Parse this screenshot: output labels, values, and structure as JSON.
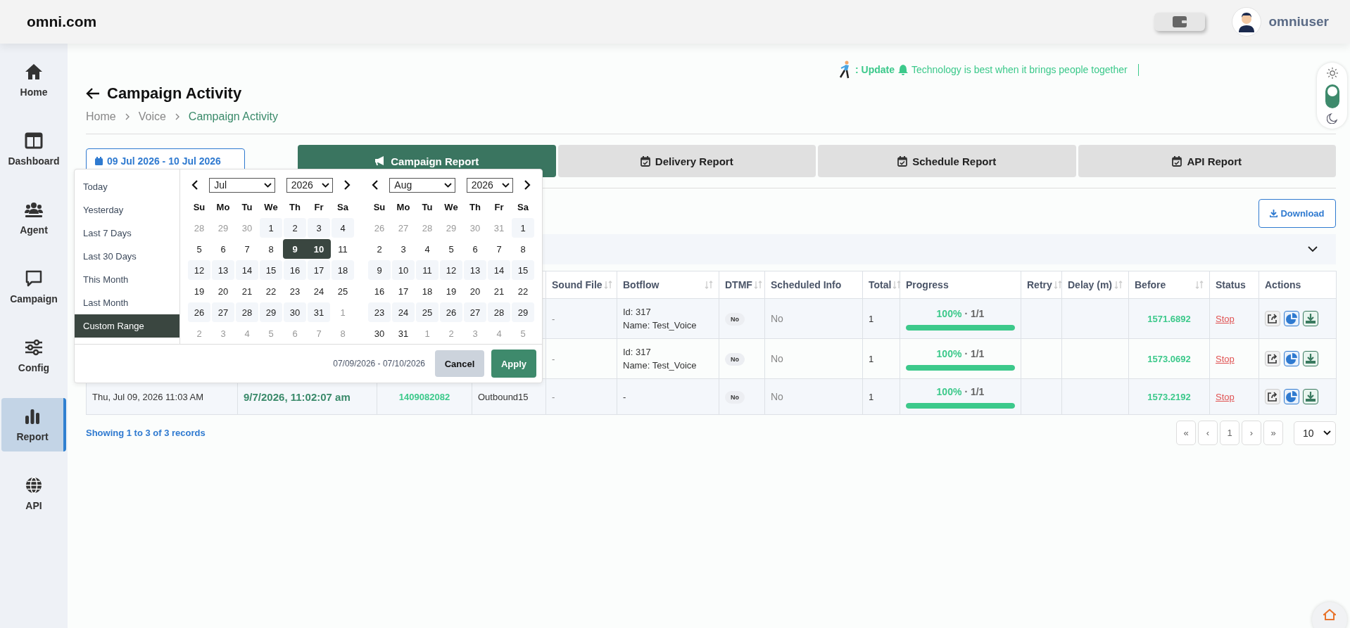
{
  "header": {
    "logo": "omni.com",
    "user": "omniuser"
  },
  "sidebar": {
    "items": [
      {
        "label": "Home",
        "selected": false
      },
      {
        "label": "Dashboard",
        "selected": false
      },
      {
        "label": "Agent",
        "selected": false
      },
      {
        "label": "Campaign",
        "selected": false
      },
      {
        "label": "Config",
        "selected": false
      },
      {
        "label": "Report",
        "selected": true
      },
      {
        "label": "API",
        "selected": false
      }
    ]
  },
  "ticker": {
    "label": ": Update",
    "message": "Technology is best when it brings people together"
  },
  "theme_toggle": {
    "on": false
  },
  "page": {
    "title": "Campaign Activity",
    "breadcrumb": [
      "Home",
      "Voice",
      "Campaign Activity"
    ]
  },
  "date_range": {
    "value": "09 Jul 2026 - 10 Jul 2026"
  },
  "tabs": [
    {
      "label": "Campaign Report",
      "selected": true
    },
    {
      "label": "Delivery Report",
      "selected": false
    },
    {
      "label": "Schedule Report",
      "selected": false
    },
    {
      "label": "API Report",
      "selected": false
    }
  ],
  "download_button": "Download",
  "date_picker": {
    "ranges": [
      {
        "label": "Today",
        "selected": false
      },
      {
        "label": "Yesterday",
        "selected": false
      },
      {
        "label": "Last 7 Days",
        "selected": false
      },
      {
        "label": "Last 30 Days",
        "selected": false
      },
      {
        "label": "This Month",
        "selected": false
      },
      {
        "label": "Last Month",
        "selected": false
      },
      {
        "label": "Custom Range",
        "selected": true
      }
    ],
    "calendars": [
      {
        "month": "Jul",
        "year": "2026",
        "days_of_week": [
          "Su",
          "Mo",
          "Tu",
          "We",
          "Th",
          "Fr",
          "Sa"
        ],
        "weeks": [
          [
            {
              "day": "28",
              "outside": true,
              "selected": false
            },
            {
              "day": "29",
              "outside": true,
              "selected": false
            },
            {
              "day": "30",
              "outside": true,
              "selected": false
            },
            {
              "day": "1",
              "outside": false,
              "selected": false
            },
            {
              "day": "2",
              "outside": false,
              "selected": false
            },
            {
              "day": "3",
              "outside": false,
              "selected": false
            },
            {
              "day": "4",
              "outside": false,
              "selected": false
            }
          ],
          [
            {
              "day": "5",
              "outside": false,
              "selected": false
            },
            {
              "day": "6",
              "outside": false,
              "selected": false
            },
            {
              "day": "7",
              "outside": false,
              "selected": false
            },
            {
              "day": "8",
              "outside": false,
              "selected": false
            },
            {
              "day": "9",
              "outside": false,
              "selected": true
            },
            {
              "day": "10",
              "outside": false,
              "selected": true
            },
            {
              "day": "11",
              "outside": false,
              "selected": false
            }
          ],
          [
            {
              "day": "12",
              "outside": false,
              "selected": false
            },
            {
              "day": "13",
              "outside": false,
              "selected": false
            },
            {
              "day": "14",
              "outside": false,
              "selected": false
            },
            {
              "day": "15",
              "outside": false,
              "selected": false
            },
            {
              "day": "16",
              "outside": false,
              "selected": false
            },
            {
              "day": "17",
              "outside": false,
              "selected": false
            },
            {
              "day": "18",
              "outside": false,
              "selected": false
            }
          ],
          [
            {
              "day": "19",
              "outside": false,
              "selected": false
            },
            {
              "day": "20",
              "outside": false,
              "selected": false
            },
            {
              "day": "21",
              "outside": false,
              "selected": false
            },
            {
              "day": "22",
              "outside": false,
              "selected": false
            },
            {
              "day": "23",
              "outside": false,
              "selected": false
            },
            {
              "day": "24",
              "outside": false,
              "selected": false
            },
            {
              "day": "25",
              "outside": false,
              "selected": false
            }
          ],
          [
            {
              "day": "26",
              "outside": false,
              "selected": false
            },
            {
              "day": "27",
              "outside": false,
              "selected": false
            },
            {
              "day": "28",
              "outside": false,
              "selected": false
            },
            {
              "day": "29",
              "outside": false,
              "selected": false
            },
            {
              "day": "30",
              "outside": false,
              "selected": false
            },
            {
              "day": "31",
              "outside": false,
              "selected": false
            },
            {
              "day": "1",
              "outside": true,
              "selected": false
            }
          ],
          [
            {
              "day": "2",
              "outside": true,
              "selected": false
            },
            {
              "day": "3",
              "outside": true,
              "selected": false
            },
            {
              "day": "4",
              "outside": true,
              "selected": false
            },
            {
              "day": "5",
              "outside": true,
              "selected": false
            },
            {
              "day": "6",
              "outside": true,
              "selected": false
            },
            {
              "day": "7",
              "outside": true,
              "selected": false
            },
            {
              "day": "8",
              "outside": true,
              "selected": false
            }
          ]
        ]
      },
      {
        "month": "Aug",
        "year": "2026",
        "days_of_week": [
          "Su",
          "Mo",
          "Tu",
          "We",
          "Th",
          "Fr",
          "Sa"
        ],
        "weeks": [
          [
            {
              "day": "26",
              "outside": true,
              "selected": false
            },
            {
              "day": "27",
              "outside": true,
              "selected": false
            },
            {
              "day": "28",
              "outside": true,
              "selected": false
            },
            {
              "day": "29",
              "outside": true,
              "selected": false
            },
            {
              "day": "30",
              "outside": true,
              "selected": false
            },
            {
              "day": "31",
              "outside": true,
              "selected": false
            },
            {
              "day": "1",
              "outside": false,
              "selected": false
            }
          ],
          [
            {
              "day": "2",
              "outside": false,
              "selected": false
            },
            {
              "day": "3",
              "outside": false,
              "selected": false
            },
            {
              "day": "4",
              "outside": false,
              "selected": false
            },
            {
              "day": "5",
              "outside": false,
              "selected": false
            },
            {
              "day": "6",
              "outside": false,
              "selected": false
            },
            {
              "day": "7",
              "outside": false,
              "selected": false
            },
            {
              "day": "8",
              "outside": false,
              "selected": false
            }
          ],
          [
            {
              "day": "9",
              "outside": false,
              "selected": false
            },
            {
              "day": "10",
              "outside": false,
              "selected": false
            },
            {
              "day": "11",
              "outside": false,
              "selected": false
            },
            {
              "day": "12",
              "outside": false,
              "selected": false
            },
            {
              "day": "13",
              "outside": false,
              "selected": false
            },
            {
              "day": "14",
              "outside": false,
              "selected": false
            },
            {
              "day": "15",
              "outside": false,
              "selected": false
            }
          ],
          [
            {
              "day": "16",
              "outside": false,
              "selected": false
            },
            {
              "day": "17",
              "outside": false,
              "selected": false
            },
            {
              "day": "18",
              "outside": false,
              "selected": false
            },
            {
              "day": "19",
              "outside": false,
              "selected": false
            },
            {
              "day": "20",
              "outside": false,
              "selected": false
            },
            {
              "day": "21",
              "outside": false,
              "selected": false
            },
            {
              "day": "22",
              "outside": false,
              "selected": false
            }
          ],
          [
            {
              "day": "23",
              "outside": false,
              "selected": false
            },
            {
              "day": "24",
              "outside": false,
              "selected": false
            },
            {
              "day": "25",
              "outside": false,
              "selected": false
            },
            {
              "day": "26",
              "outside": false,
              "selected": false
            },
            {
              "day": "27",
              "outside": false,
              "selected": false
            },
            {
              "day": "28",
              "outside": false,
              "selected": false
            },
            {
              "day": "29",
              "outside": false,
              "selected": false
            }
          ],
          [
            {
              "day": "30",
              "outside": false,
              "selected": false
            },
            {
              "day": "31",
              "outside": false,
              "selected": false
            },
            {
              "day": "1",
              "outside": true,
              "selected": false
            },
            {
              "day": "2",
              "outside": true,
              "selected": false
            },
            {
              "day": "3",
              "outside": true,
              "selected": false
            },
            {
              "day": "4",
              "outside": true,
              "selected": false
            },
            {
              "day": "5",
              "outside": true,
              "selected": false
            }
          ]
        ]
      }
    ],
    "selection": "07/09/2026 - 07/10/2026",
    "cancel": "Cancel",
    "apply": "Apply"
  },
  "table": {
    "columns": [
      {},
      {},
      {},
      {},
      {
        "label": "Sound File",
        "sortable": true
      },
      {
        "label": "Botflow",
        "sortable": true
      },
      {
        "label": "DTMF",
        "sortable": true
      },
      {
        "label": "Scheduled Info",
        "sortable": false
      },
      {
        "label": "Total",
        "sortable": true
      },
      {
        "label": "Progress",
        "sortable": false
      },
      {
        "label": "Retry",
        "sortable": true
      },
      {
        "label": "Delay (m)",
        "sortable": true
      },
      {
        "label": "Before",
        "sortable": true
      },
      {
        "label": "Status",
        "sortable": false
      },
      {
        "label": "Actions",
        "sortable": false
      }
    ],
    "rows": [
      {
        "sound_file": "-",
        "botflow": [
          "Id: 317",
          "Name: Test_Voice"
        ],
        "dtmf": "No",
        "scheduled_info": "No",
        "total": "1",
        "progress": {
          "percent": "100%",
          "count": "· 1/1",
          "level": 1
        },
        "before": "1571.6892",
        "status": "Stop"
      },
      {
        "sound_file": "-",
        "botflow": [
          "Id: 317",
          "Name: Test_Voice"
        ],
        "dtmf": "No",
        "scheduled_info": "No",
        "total": "1",
        "progress": {
          "percent": "100%",
          "count": "· 1/1",
          "level": 1
        },
        "before": "1573.0692",
        "status": "Stop"
      },
      {
        "created": "Thu, Jul 09, 2026 11:03 AM",
        "started": "9/7/2026, 11:02:07 am",
        "number": "1409082082",
        "campaign": "Outbound15",
        "sound_file": "-",
        "botflow": [
          "-"
        ],
        "dtmf": "No",
        "scheduled_info": "No",
        "total": "1",
        "progress": {
          "percent": "100%",
          "count": "· 1/1",
          "level": 1
        },
        "before": "1573.2192",
        "status": "Stop"
      }
    ]
  },
  "summary": "Showing 1 to 3 of 3 records",
  "pagination": {
    "pages": [
      "«",
      "‹",
      "1",
      "›",
      "»"
    ],
    "page_size": "10"
  }
}
